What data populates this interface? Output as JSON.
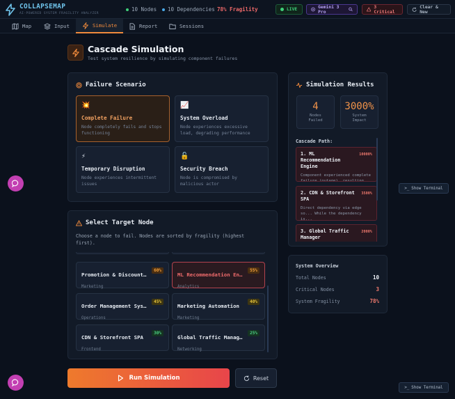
{
  "app": {
    "name": "COLLAPSEMAP",
    "subtitle": "AI-POWERED SYSTEM FRAGILITY ANALYZER"
  },
  "header": {
    "nodes": "10 Nodes",
    "dependencies": "10 Dependencies",
    "fragility": "78% Fragility",
    "live": "LIVE",
    "model": "Gemini 3 Pro",
    "critical": "3 Critical",
    "clear": "Clear & New"
  },
  "tabs": [
    {
      "label": "Map"
    },
    {
      "label": "Input"
    },
    {
      "label": "Simulate"
    },
    {
      "label": "Report"
    },
    {
      "label": "Sessions"
    }
  ],
  "page": {
    "title": "Cascade Simulation",
    "subtitle": "Test system resilience by simulating component failures"
  },
  "scenario": {
    "title": "Failure Scenario",
    "options": [
      {
        "title": "Complete Failure",
        "desc": "Node completely fails and stops functioning"
      },
      {
        "title": "System Overload",
        "desc": "Node experiences excessive load, degrading performance"
      },
      {
        "title": "Temporary Disruption",
        "desc": "Node experiences intermittent issues"
      },
      {
        "title": "Security Breach",
        "desc": "Node is compromised by malicious actor"
      }
    ]
  },
  "target": {
    "title": "Select Target Node",
    "hint": "Choose a node to fail. Nodes are sorted by fragility (highest first).",
    "nodes": [
      {
        "name": "Promotion & Discount Engine",
        "pct": "60%",
        "cat": "Marketing"
      },
      {
        "name": "ML Recommendation Engine",
        "pct": "55%",
        "cat": "Analytics"
      },
      {
        "name": "Order Management System",
        "pct": "45%",
        "cat": "Operations"
      },
      {
        "name": "Marketing Automation",
        "pct": "40%",
        "cat": "Marketing"
      },
      {
        "name": "CDN & Storefront SPA",
        "pct": "30%",
        "cat": "Frontend"
      },
      {
        "name": "Global Traffic Manager",
        "pct": "25%",
        "cat": "Networking"
      }
    ]
  },
  "actions": {
    "run": "Run Simulation",
    "reset": "Reset"
  },
  "results": {
    "title": "Simulation Results",
    "nodes_failed": "4",
    "nodes_failed_label": "Nodes Failed",
    "impact": "3000%",
    "impact_label": "System Impact",
    "cascade_label": "Cascade Path:",
    "cascade": [
      {
        "title": "1. ML Recommendation Engine",
        "pct": "10000%",
        "desc": "Component experienced complete failure (outage), resulting i..."
      },
      {
        "title": "2. CDN & Storefront SPA",
        "pct": "3500%",
        "desc": "Direct dependency via edge so... While the dependency is..."
      },
      {
        "title": "3. Global Traffic Manager",
        "pct": "2000%",
        "desc": ""
      }
    ]
  },
  "overview": {
    "title": "System Overview",
    "total_label": "Total Nodes",
    "total": "10",
    "critical_label": "Critical Nodes",
    "critical": "3",
    "fragility_label": "System Fragility",
    "fragility": "78%"
  },
  "side": {
    "terminal": "Show Terminal"
  },
  "colors": {
    "accent": "#f08a3c",
    "critical": "#f07a6e",
    "live": "#3fd07a",
    "brand": "#6fc3ea"
  }
}
